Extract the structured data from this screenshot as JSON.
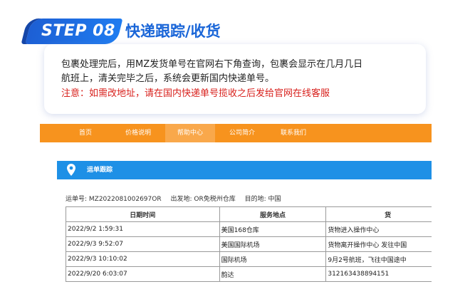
{
  "step": {
    "badge": "STEP 08",
    "title": "快递跟踪/收货"
  },
  "card": {
    "line1": "包裹处理完后，用MZ发货单号在官网右下角查询，包裹会显示在几月几日",
    "line2": "航班上，清关完毕之后，系统会更新国内快递单号。",
    "notice": "注意：如需改地址，请在国内快递单号揽收之后发给官网在线客服"
  },
  "nav": {
    "items": [
      "首页",
      "价格说明",
      "帮助中心",
      "公司简介",
      "联系我们"
    ],
    "active_index": 2
  },
  "panel": {
    "title": "运单跟踪",
    "icon": "location-pin-icon"
  },
  "meta": {
    "waybill": "运单号: MZ2022081002697OR",
    "origin": "出发地: OR免税州仓库",
    "destination": "目的地: 中国"
  },
  "table": {
    "headers": [
      "日期时间",
      "服务地点",
      "货"
    ],
    "rows": [
      [
        "2022/9/2 1:59:31",
        "美国168仓库",
        "货物进入操作中心"
      ],
      [
        "2022/9/3 9:52:07",
        "美国国际机场",
        "货物离开操作中心 发往中国"
      ],
      [
        "2022/9/3 10:10:02",
        "国际机场",
        "9月2号航班，飞往中国途中"
      ],
      [
        "2022/9/20 6:03:07",
        "韵达",
        "312163438894151"
      ]
    ]
  },
  "colors": {
    "brand_blue": "#1a66d8",
    "nav_orange": "#f7931e",
    "panel_blue": "#1e90e6",
    "notice_red": "#d8201c"
  }
}
